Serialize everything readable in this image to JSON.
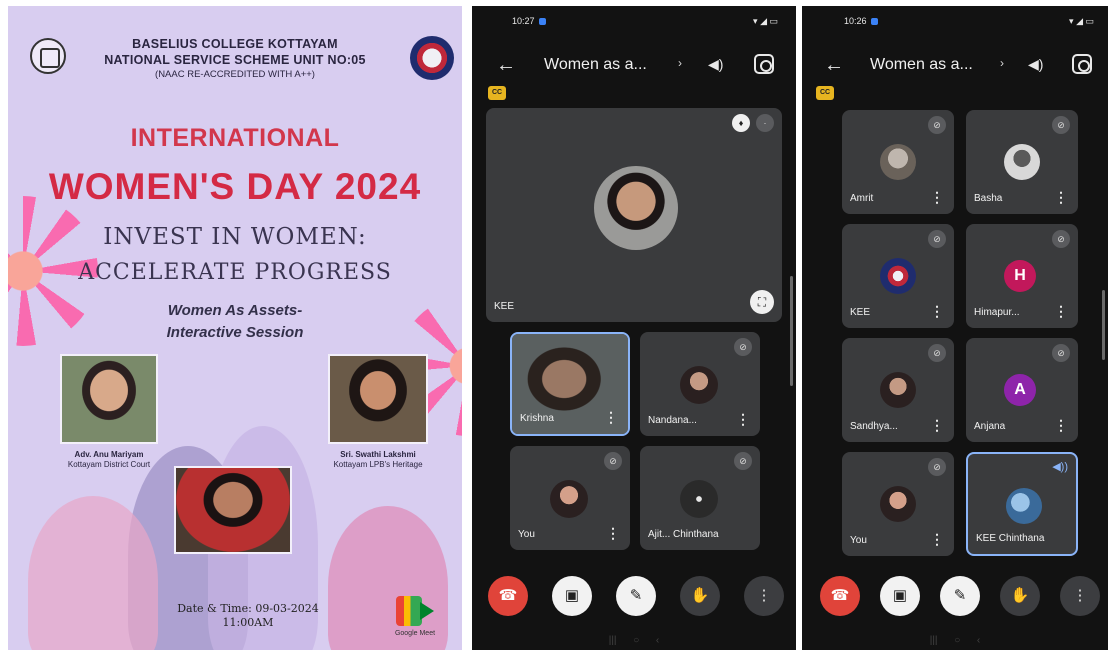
{
  "poster": {
    "college": "BASELIUS COLLEGE KOTTAYAM",
    "unit": "NATIONAL SERVICE SCHEME UNIT NO:05",
    "naac": "(NAAC RE-ACCREDITED WITH A++)",
    "title1": "INTERNATIONAL",
    "title2": "WOMEN'S DAY 2024",
    "theme1": "INVEST IN WOMEN:",
    "theme2": "ACCELERATE PROGRESS",
    "session1": "Women As Assets-",
    "session2": "Interactive Session",
    "speaker1_name": "Adv. Anu Mariyam",
    "speaker1_role": "Kottayam District Court",
    "speaker2_name": "Sri. Swathi Lakshmi",
    "speaker2_role": "Kottayam LPB's Heritage",
    "date_time": "Date & Time: 09-03-2024",
    "time": "11:00AM",
    "meet_label": "Google Meet"
  },
  "phone1": {
    "status_time": "10:27",
    "meeting_title": "Women as a...",
    "main_tile_name": "KEE",
    "tiles": [
      {
        "name": "Krishna"
      },
      {
        "name": "Nandana..."
      },
      {
        "name": "You"
      },
      {
        "name": "Ajit... Chinthana"
      }
    ]
  },
  "phone2": {
    "status_time": "10:26",
    "meeting_title": "Women as a...",
    "tiles": [
      {
        "name": "Amrit"
      },
      {
        "name": "Basha"
      },
      {
        "name": "KEE",
        "letter": ""
      },
      {
        "name": "Himapur...",
        "letter": "H"
      },
      {
        "name": "Sandhya..."
      },
      {
        "name": "Anjana",
        "letter": "A"
      },
      {
        "name": "You"
      },
      {
        "name": "KEE Chinthana"
      }
    ]
  },
  "colors": {
    "poster_bg": "#d8cdf0",
    "title_red": "#d42a45",
    "meet_bg": "#121212",
    "tile_bg": "#3a3b3d",
    "end_call": "#e0443a",
    "avatar_h": "#c2185b",
    "avatar_a": "#8e24aa"
  }
}
